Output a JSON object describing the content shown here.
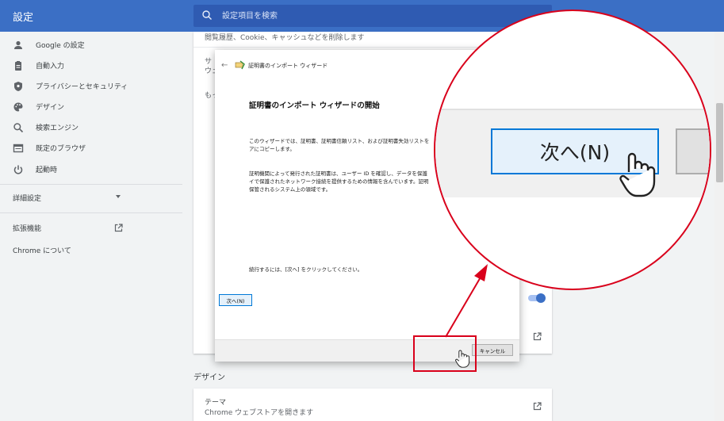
{
  "header": {
    "title": "設定",
    "search_placeholder": "設定項目を検索"
  },
  "sidebar": {
    "items": [
      {
        "label": "Google の設定",
        "icon": "person-icon"
      },
      {
        "label": "自動入力",
        "icon": "clipboard-icon"
      },
      {
        "label": "プライバシーとセキュリティ",
        "icon": "shield-icon"
      },
      {
        "label": "デザイン",
        "icon": "palette-icon"
      },
      {
        "label": "検索エンジン",
        "icon": "search-icon"
      },
      {
        "label": "既定のブラウザ",
        "icon": "browser-icon"
      },
      {
        "label": "起動時",
        "icon": "power-icon"
      }
    ],
    "advanced": "詳細設定",
    "extensions": "拡張機能",
    "about": "Chrome について"
  },
  "main": {
    "top_row_text": "閲覧履歴、Cookie、キャッシュなどを削除します",
    "partial_row1_line1": "サ",
    "partial_row1_line2": "ウェ",
    "partial_row2": "もっ",
    "design_section_title": "デザイン",
    "theme_title": "テーマ",
    "theme_subtitle": "Chrome ウェブストアを開きます"
  },
  "dialog": {
    "header": "証明書のインポート ウィザード",
    "heading": "証明書のインポート ウィザードの開始",
    "para1_line1": "このウィザードでは、証明書、証明書信頼リスト、および証明書失効リストを",
    "para1_line2": "アにコピーします。",
    "para2_line1": "証明機関によって発行された証明書は、ユーザー ID を確認し、データを保護",
    "para2_line2": "イで保護されたネットワーク接続を提供するための情報を含んでいます。証明",
    "para2_line3": "保管されるシステム上の領域です。",
    "continue_text": "続行するには、[次へ] をクリックしてください。",
    "next_button": "次へ(N)",
    "cancel_button": "キャンセル"
  },
  "magnifier": {
    "next_button": "次へ(N)"
  },
  "colors": {
    "header_blue": "#3b6fc5",
    "highlight_red": "#d9001b",
    "button_focus_blue": "#0078d7"
  }
}
